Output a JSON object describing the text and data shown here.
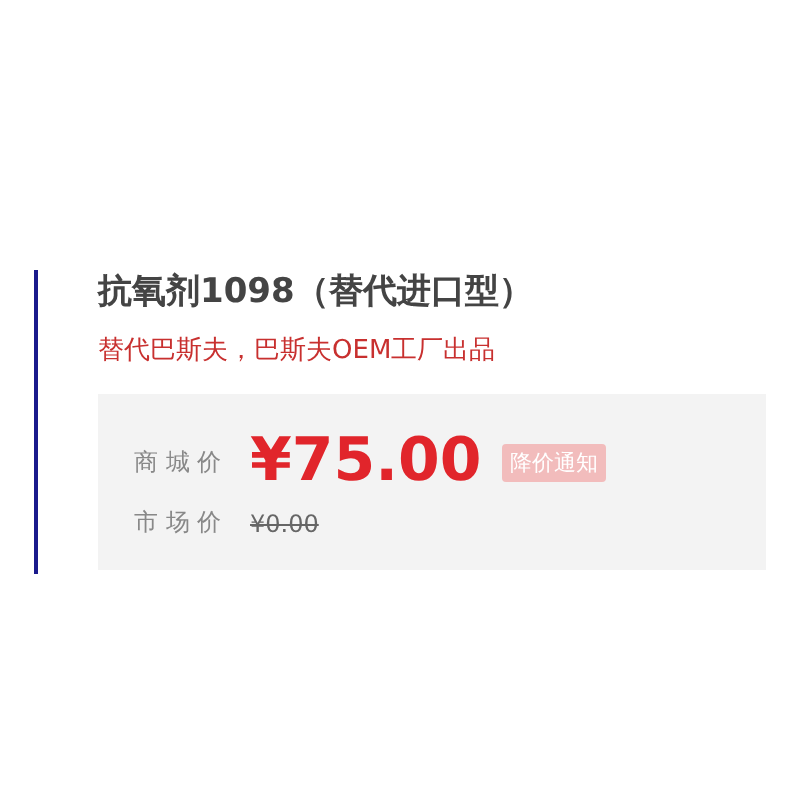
{
  "product": {
    "title": "抗氧剂1098（替代进口型）",
    "subtitle": "替代巴斯夫，巴斯夫OEM工厂出品"
  },
  "price_box": {
    "mall_price_label": "商 城 价",
    "mall_price": "¥75.00",
    "price_alert_button": "降价通知",
    "market_price_label": "市 场 价",
    "market_price": "¥0.00"
  }
}
